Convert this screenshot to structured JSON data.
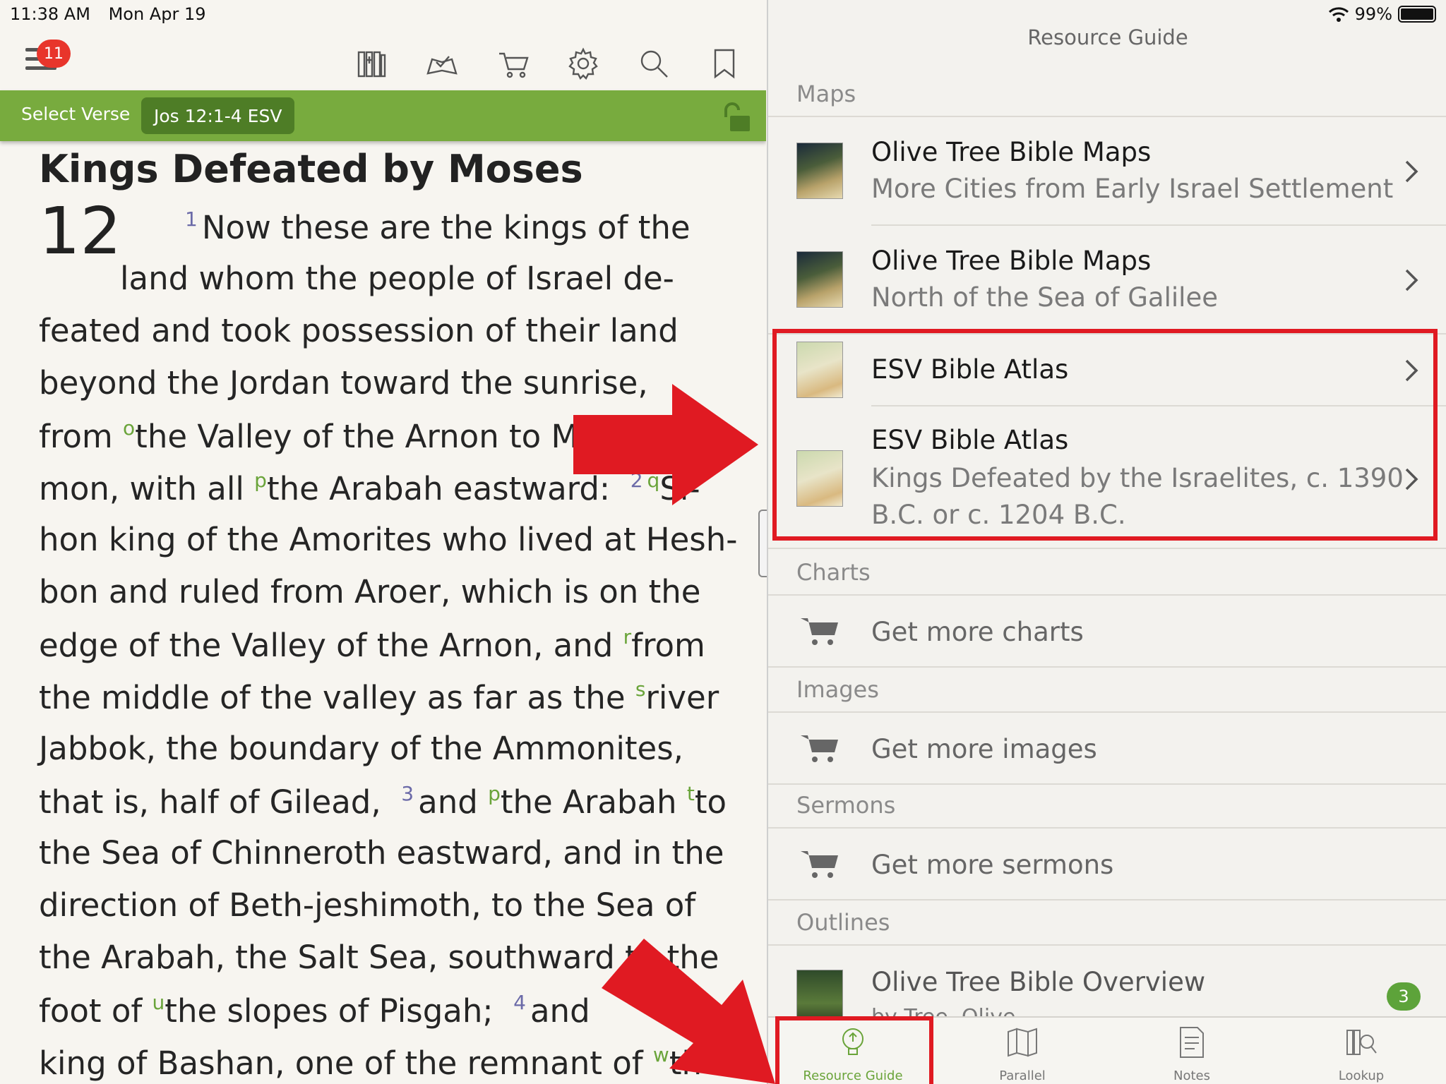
{
  "status": {
    "time": "11:38 AM",
    "date": "Mon Apr 19",
    "battery": "99%"
  },
  "toolbar": {
    "badge_count": "11"
  },
  "verse_bar": {
    "select_verse": "Select Verse",
    "reference": "Jos 12:1-4 ESV"
  },
  "passage": {
    "heading": "Kings Defeated by Moses",
    "chapter": "12",
    "lines": [
      {
        "verse": "1",
        "text": "Now these are the kings of the"
      },
      {
        "text": "land whom the people of Israel de-"
      },
      {
        "text": "feated and took possession of their land"
      },
      {
        "text": "beyond the Jordan toward the sunrise,"
      },
      {
        "pre": "from ",
        "fn": "o",
        "text": "the Valley of the Arnon to Mo"
      },
      {
        "pre": "mon, with all ",
        "fn": "p",
        "text": "the Arabah eastward:",
        "verse2": "2",
        "fn2": "q",
        "tail": "Si-"
      },
      {
        "text": "hon king of the Amorites who lived at Hesh-"
      },
      {
        "text": "bon and ruled from Aroer, which is on the"
      },
      {
        "pre": "edge of the Valley of the Arnon, and ",
        "fn": "r",
        "text": "from"
      },
      {
        "pre": "the middle of the valley as far as the ",
        "fn": "s",
        "text": "river"
      },
      {
        "text": "Jabbok, the boundary of the Ammonites,"
      },
      {
        "pre": "that is, half of Gilead,",
        "verse2": "3",
        "tail2": "and ",
        "fn": "p",
        "text": "the Arabah ",
        "fn2": "t",
        "tail": "to"
      },
      {
        "text": "the Sea of Chinneroth eastward, and in the"
      },
      {
        "text": "direction of Beth-jeshimoth, to the Sea of"
      },
      {
        "text": "the Arabah, the Salt Sea, southward to the"
      },
      {
        "pre": "foot of ",
        "fn": "u",
        "text": "the slopes of Pisgah;",
        "verse2": "4",
        "tail": "and"
      },
      {
        "pre": "king of Bashan, one of the remnant of ",
        "fn": "w",
        "text": "the"
      }
    ]
  },
  "resource_guide": {
    "title": "Resource Guide",
    "sections": {
      "maps": "Maps",
      "charts": "Charts",
      "images": "Images",
      "sermons": "Sermons",
      "outlines": "Outlines"
    },
    "maps_items": [
      {
        "title": "Olive Tree Bible Maps",
        "subtitle": "More Cities from Early Israel Settlement"
      },
      {
        "title": "Olive Tree Bible Maps",
        "subtitle": "North of the Sea of Galilee"
      },
      {
        "title": "ESV Bible Atlas",
        "subtitle": ""
      },
      {
        "title": "ESV Bible Atlas",
        "subtitle_line1": "Kings Defeated by the Israelites, c. 1390",
        "subtitle_line2": "B.C. or c. 1204 B.C."
      }
    ],
    "charts_action": "Get more charts",
    "images_action": "Get more images",
    "sermons_action": "Get more sermons",
    "outline_item": {
      "title": "Olive Tree Bible Overview",
      "subtitle": "by Tree, Olive",
      "badge": "3"
    }
  },
  "tabs": [
    {
      "label": "Resource Guide",
      "active": true
    },
    {
      "label": "Parallel",
      "active": false
    },
    {
      "label": "Notes",
      "active": false
    },
    {
      "label": "Lookup",
      "active": false
    }
  ],
  "colors": {
    "accent_green": "#78ab3e",
    "annotation_red": "#e01a22",
    "badge_red": "#e8352b"
  }
}
